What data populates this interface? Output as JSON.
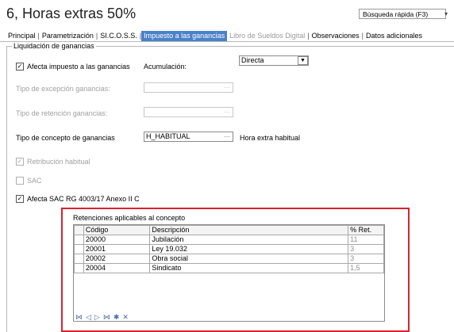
{
  "header": {
    "title": "6, Horas extras  50%",
    "search_label": "Búsqueda rápida (F3)"
  },
  "tabs": [
    {
      "label": "Principal",
      "state": "normal"
    },
    {
      "label": "Parametrización",
      "state": "normal"
    },
    {
      "label": "SI.C.O.S.S.",
      "state": "normal"
    },
    {
      "label": "Impuesto a las ganancias",
      "state": "active"
    },
    {
      "label": "Libro de Sueldos Digital",
      "state": "disabled"
    },
    {
      "label": "Observaciones",
      "state": "normal"
    },
    {
      "label": "Datos adicionales",
      "state": "normal"
    }
  ],
  "group": {
    "title": "Liquidación de ganancias"
  },
  "form": {
    "afecta_impuesto_label": "Afecta impuesto a las ganancias",
    "acumulacion_label": "Acumulación:",
    "acumulacion_value": "Directa",
    "tipo_excepcion_label": "Tipo de excepción ganancias:",
    "tipo_retencion_label": "Tipo de retención ganancias:",
    "tipo_concepto_label": "Tipo de concepto de ganancias",
    "tipo_concepto_value": "H_HABITUAL",
    "tipo_concepto_desc": "Hora extra habitual",
    "retribucion_label": "Retribución habitual",
    "sac_label": "SAC",
    "afecta_sac_label": "Afecta SAC RG 4003/17 Anexo II C",
    "dots": "···",
    "checkmark": "✓"
  },
  "retenciones": {
    "title": "Retenciones aplicables al concepto",
    "columns": [
      "Código",
      "Descripción",
      "% Ret."
    ],
    "rows": [
      [
        "20000",
        "Jubilación",
        "11"
      ],
      [
        "20001",
        "Ley 19.032",
        "3"
      ],
      [
        "20002",
        "Obra social",
        "3"
      ],
      [
        "20004",
        "Sindicato",
        "1,5"
      ]
    ],
    "nav_icons": [
      "first-icon",
      "prev-icon",
      "next-icon",
      "last-icon",
      "new-icon",
      "delete-icon"
    ],
    "nav_glyphs": [
      "⋈",
      "◁",
      "▷",
      "⋈",
      "✱",
      "✕"
    ]
  },
  "colors": {
    "active_tab": "#4a82c8",
    "highlight_border": "#d9232e"
  }
}
